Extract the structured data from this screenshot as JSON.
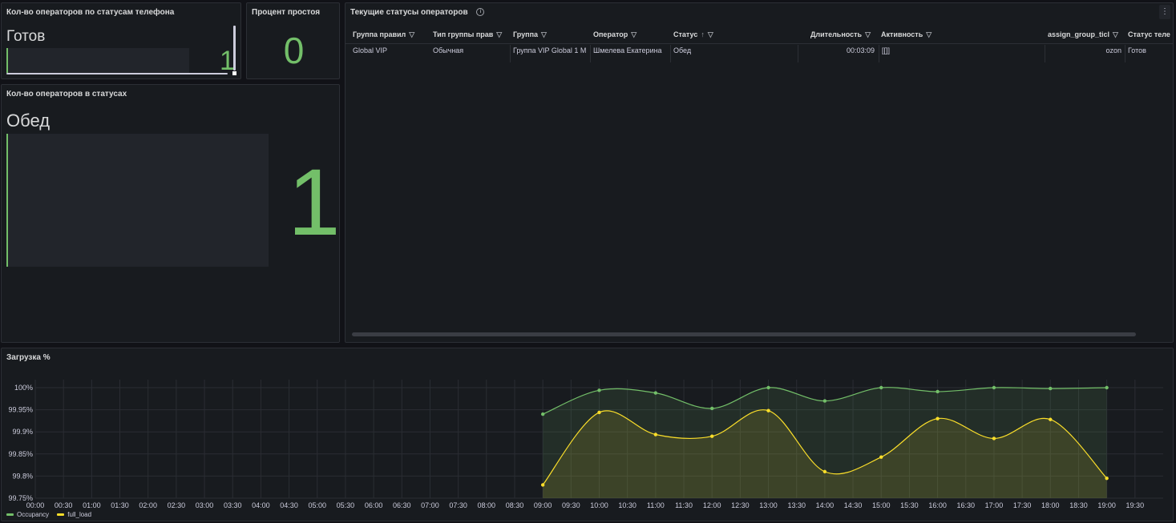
{
  "panels": {
    "phone_status": {
      "title": "Кол-во операторов по статусам телефона",
      "label": "Готов",
      "value": "1"
    },
    "idle_percent": {
      "title": "Процент простоя",
      "value": "0"
    },
    "status_count": {
      "title": "Кол-во операторов в статусах",
      "label": "Обед",
      "value": "1"
    },
    "current_statuses": {
      "title": "Текущие статусы операторов",
      "info_icon": "info-icon",
      "menu_icon": "kebab-menu-icon",
      "columns": [
        "Группа правил",
        "Тип группы прав",
        "Группа",
        "Оператор",
        "Статус",
        "Длительность",
        "Активность",
        "assign_group_ticl",
        "Статус теле"
      ],
      "sort_indicator": "↑",
      "rows": [
        [
          "Global VIP",
          "Обычная",
          "Группа VIP Global 1 М",
          "Шмелева Екатерина",
          "Обед",
          "00:03:09",
          "[[]]",
          "ozon",
          "Готов"
        ]
      ]
    },
    "load": {
      "title": "Загрузка %"
    }
  },
  "chart_data": {
    "type": "line",
    "title": "Загрузка %",
    "x_ticks": [
      "00:00",
      "00:30",
      "01:00",
      "01:30",
      "02:00",
      "02:30",
      "03:00",
      "03:30",
      "04:00",
      "04:30",
      "05:00",
      "05:30",
      "06:00",
      "06:30",
      "07:00",
      "07:30",
      "08:00",
      "08:30",
      "09:00",
      "09:30",
      "10:00",
      "10:30",
      "11:00",
      "11:30",
      "12:00",
      "12:30",
      "13:00",
      "13:30",
      "14:00",
      "14:30",
      "15:00",
      "15:30",
      "16:00",
      "16:30",
      "17:00",
      "17:30",
      "18:00",
      "18:30",
      "19:00",
      "19:30"
    ],
    "y_ticks": [
      "99.75%",
      "99.8%",
      "99.85%",
      "99.9%",
      "99.95%",
      "100%"
    ],
    "ylim": [
      99.75,
      100.0
    ],
    "x": [
      "09:00",
      "10:00",
      "11:00",
      "12:00",
      "13:00",
      "14:00",
      "15:00",
      "16:00",
      "17:00",
      "18:00",
      "19:00"
    ],
    "series": [
      {
        "name": "Occupancy",
        "color": "#73bf69",
        "values": [
          99.94,
          99.994,
          99.988,
          99.953,
          100.0,
          99.97,
          100.0,
          99.991,
          100.0,
          99.998,
          100.0
        ]
      },
      {
        "name": "full_load",
        "color": "#fade2a",
        "values": [
          99.78,
          99.944,
          99.894,
          99.89,
          99.948,
          99.81,
          99.843,
          99.93,
          99.885,
          99.928,
          99.795
        ]
      }
    ],
    "grid": true,
    "legend": "bottom-left"
  }
}
